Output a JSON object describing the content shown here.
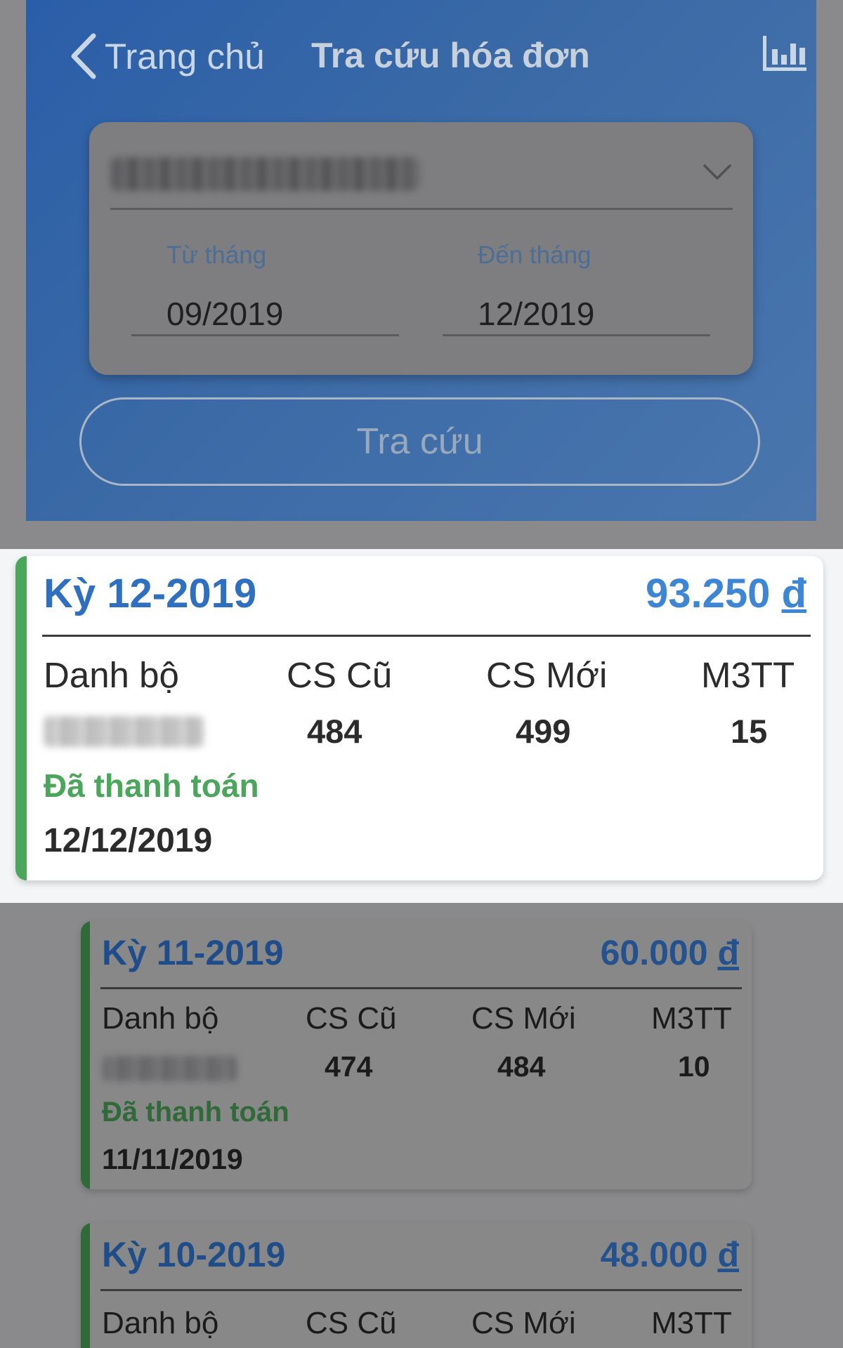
{
  "header": {
    "back_label": "Trang chủ",
    "title": "Tra cứu hóa đơn",
    "back_icon": "chevron-left-icon",
    "chart_icon": "bar-chart-icon"
  },
  "filter": {
    "account_icon": "chevron-down-icon",
    "from_label": "Từ tháng",
    "from_value": "09/2019",
    "to_label": "Đến tháng",
    "to_value": "12/2019",
    "search_label": "Tra cứu"
  },
  "columns": {
    "danh_bo": "Danh bộ",
    "cs_cu": "CS Cũ",
    "cs_moi": "CS Mới",
    "m3tt": "M3TT"
  },
  "bills": [
    {
      "period": "Kỳ 12-2019",
      "amount": "93.250",
      "currency": "đ",
      "cs_cu": "484",
      "cs_moi": "499",
      "m3tt": "15",
      "status": "Đã thanh toán",
      "date": "12/12/2019"
    },
    {
      "period": "Kỳ 11-2019",
      "amount": "60.000",
      "currency": "đ",
      "cs_cu": "474",
      "cs_moi": "484",
      "m3tt": "10",
      "status": "Đã thanh toán",
      "date": "11/11/2019"
    },
    {
      "period": "Kỳ 10-2019",
      "amount": "48.000",
      "currency": "đ"
    }
  ],
  "colors": {
    "header_blue": "#2a5ea8",
    "accent_blue": "#3d86d6",
    "paid_green": "#4aa65a"
  }
}
